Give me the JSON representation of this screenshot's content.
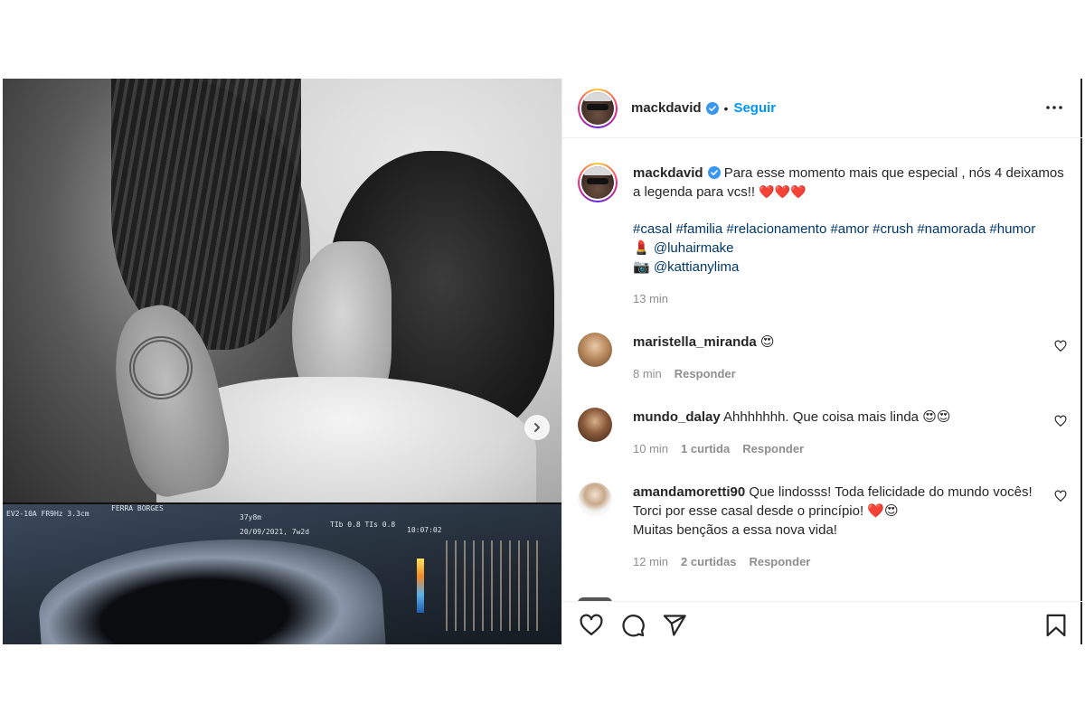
{
  "header": {
    "username": "mackdavid",
    "separator": "•",
    "follow_label": "Seguir"
  },
  "caption": {
    "username": "mackdavid",
    "text": "Para esse momento mais que especial , nós 4 deixamos a legenda para vcs!!",
    "hashtags": "#casal #familia #relacionamento #amor #crush #namorada #humor",
    "credit1_emoji": "💄",
    "credit1_handle": "@luhairmake",
    "credit2_emoji": "📷",
    "credit2_handle": "@kattianylima",
    "time": "13 min"
  },
  "comments": [
    {
      "username": "maristella_miranda",
      "text": "",
      "time": "8 min",
      "likes": "",
      "reply_label": "Responder"
    },
    {
      "username": "mundo_dalay",
      "text": "Ahhhhhhh. Que coisa mais linda",
      "time": "10 min",
      "likes": "1 curtida",
      "reply_label": "Responder"
    },
    {
      "username": "amandamoretti90",
      "text": "Que lindosss! Toda felicidade do mundo vocês! Torci por esse casal desde o princípio!",
      "text2": "Muitas bençãos a essa nova vida!",
      "time": "12 min",
      "likes": "2 curtidas",
      "reply_label": "Responder"
    }
  ],
  "media": {
    "ultrasound_text": {
      "line1": "EV2-10A FR9Hz 3.3cm",
      "name": "FERRA BORGES",
      "weeks": "37y8m",
      "date": "20/09/2021, 7w2d",
      "ti": "TIb 0.8  TIs 0.8",
      "clock": "10:07:02"
    }
  },
  "colors": {
    "accent": "#0095f6",
    "hashtag": "#00376b",
    "secondary": "#8e8e8e",
    "heart": "#ed1c24"
  },
  "icons": [
    "verified-badge-icon",
    "more-options-icon",
    "chevron-right-icon",
    "heart-icon",
    "comment-icon",
    "share-icon",
    "bookmark-icon",
    "heart-eyes-emoji"
  ]
}
